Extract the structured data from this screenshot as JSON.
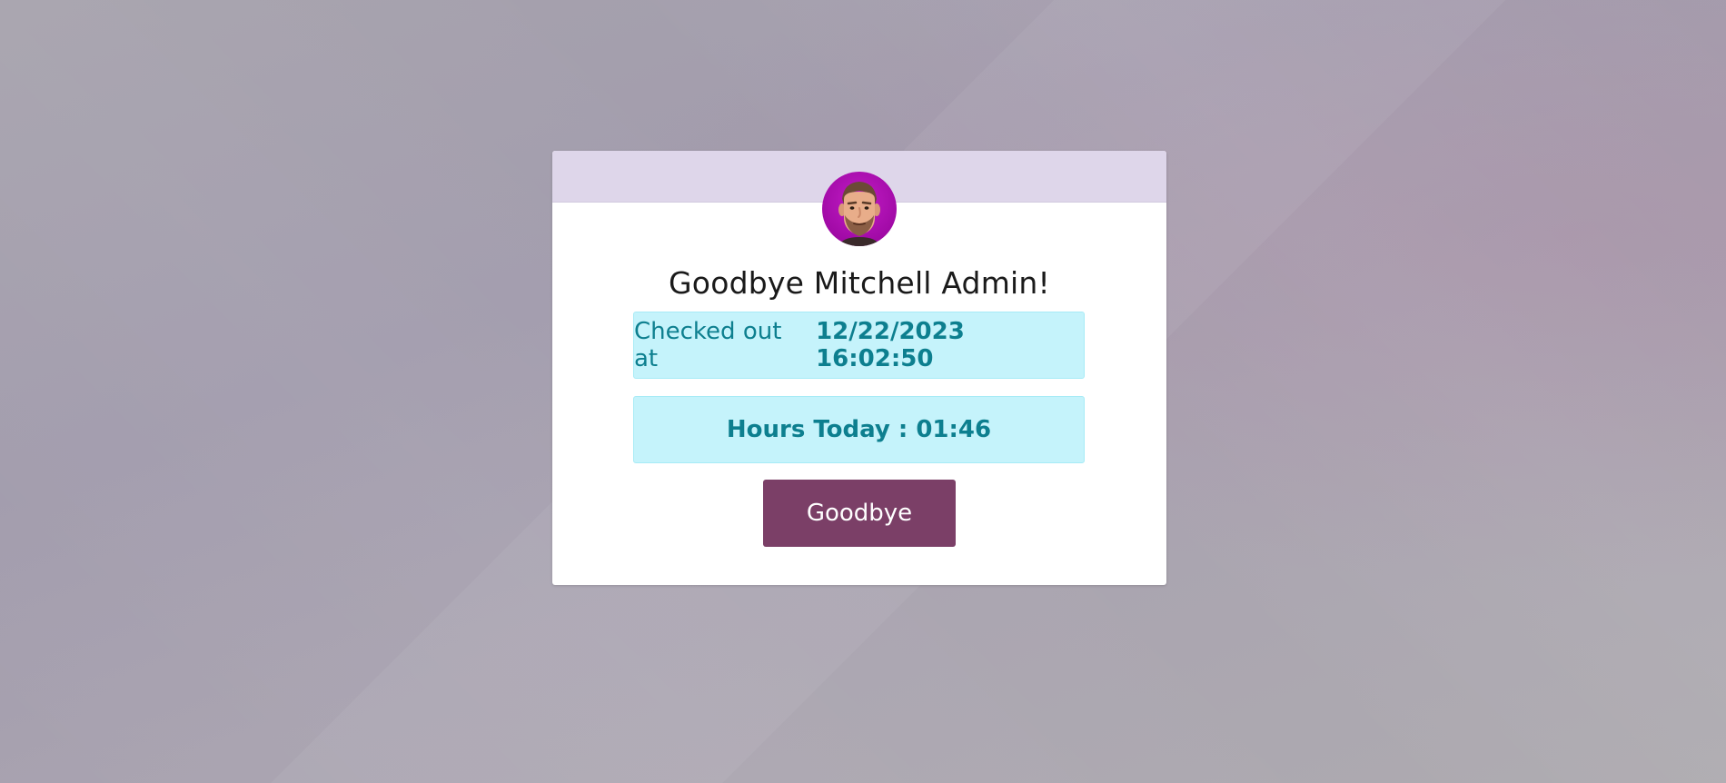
{
  "user": {
    "greeting": "Goodbye Mitchell Admin!"
  },
  "status": {
    "checkout_prefix": "Checked out at",
    "checkout_time": "12/22/2023 16:02:50",
    "hours_today": "Hours Today : 01:46"
  },
  "actions": {
    "goodbye_label": "Goodbye"
  },
  "colors": {
    "header_band": "#ded6ea",
    "alert_bg": "#c5f3fb",
    "alert_text": "#0d7f8f",
    "button_bg": "#7b3f67",
    "avatar_ring": "#b512b9"
  },
  "icons": {
    "avatar": "user-avatar-icon"
  }
}
